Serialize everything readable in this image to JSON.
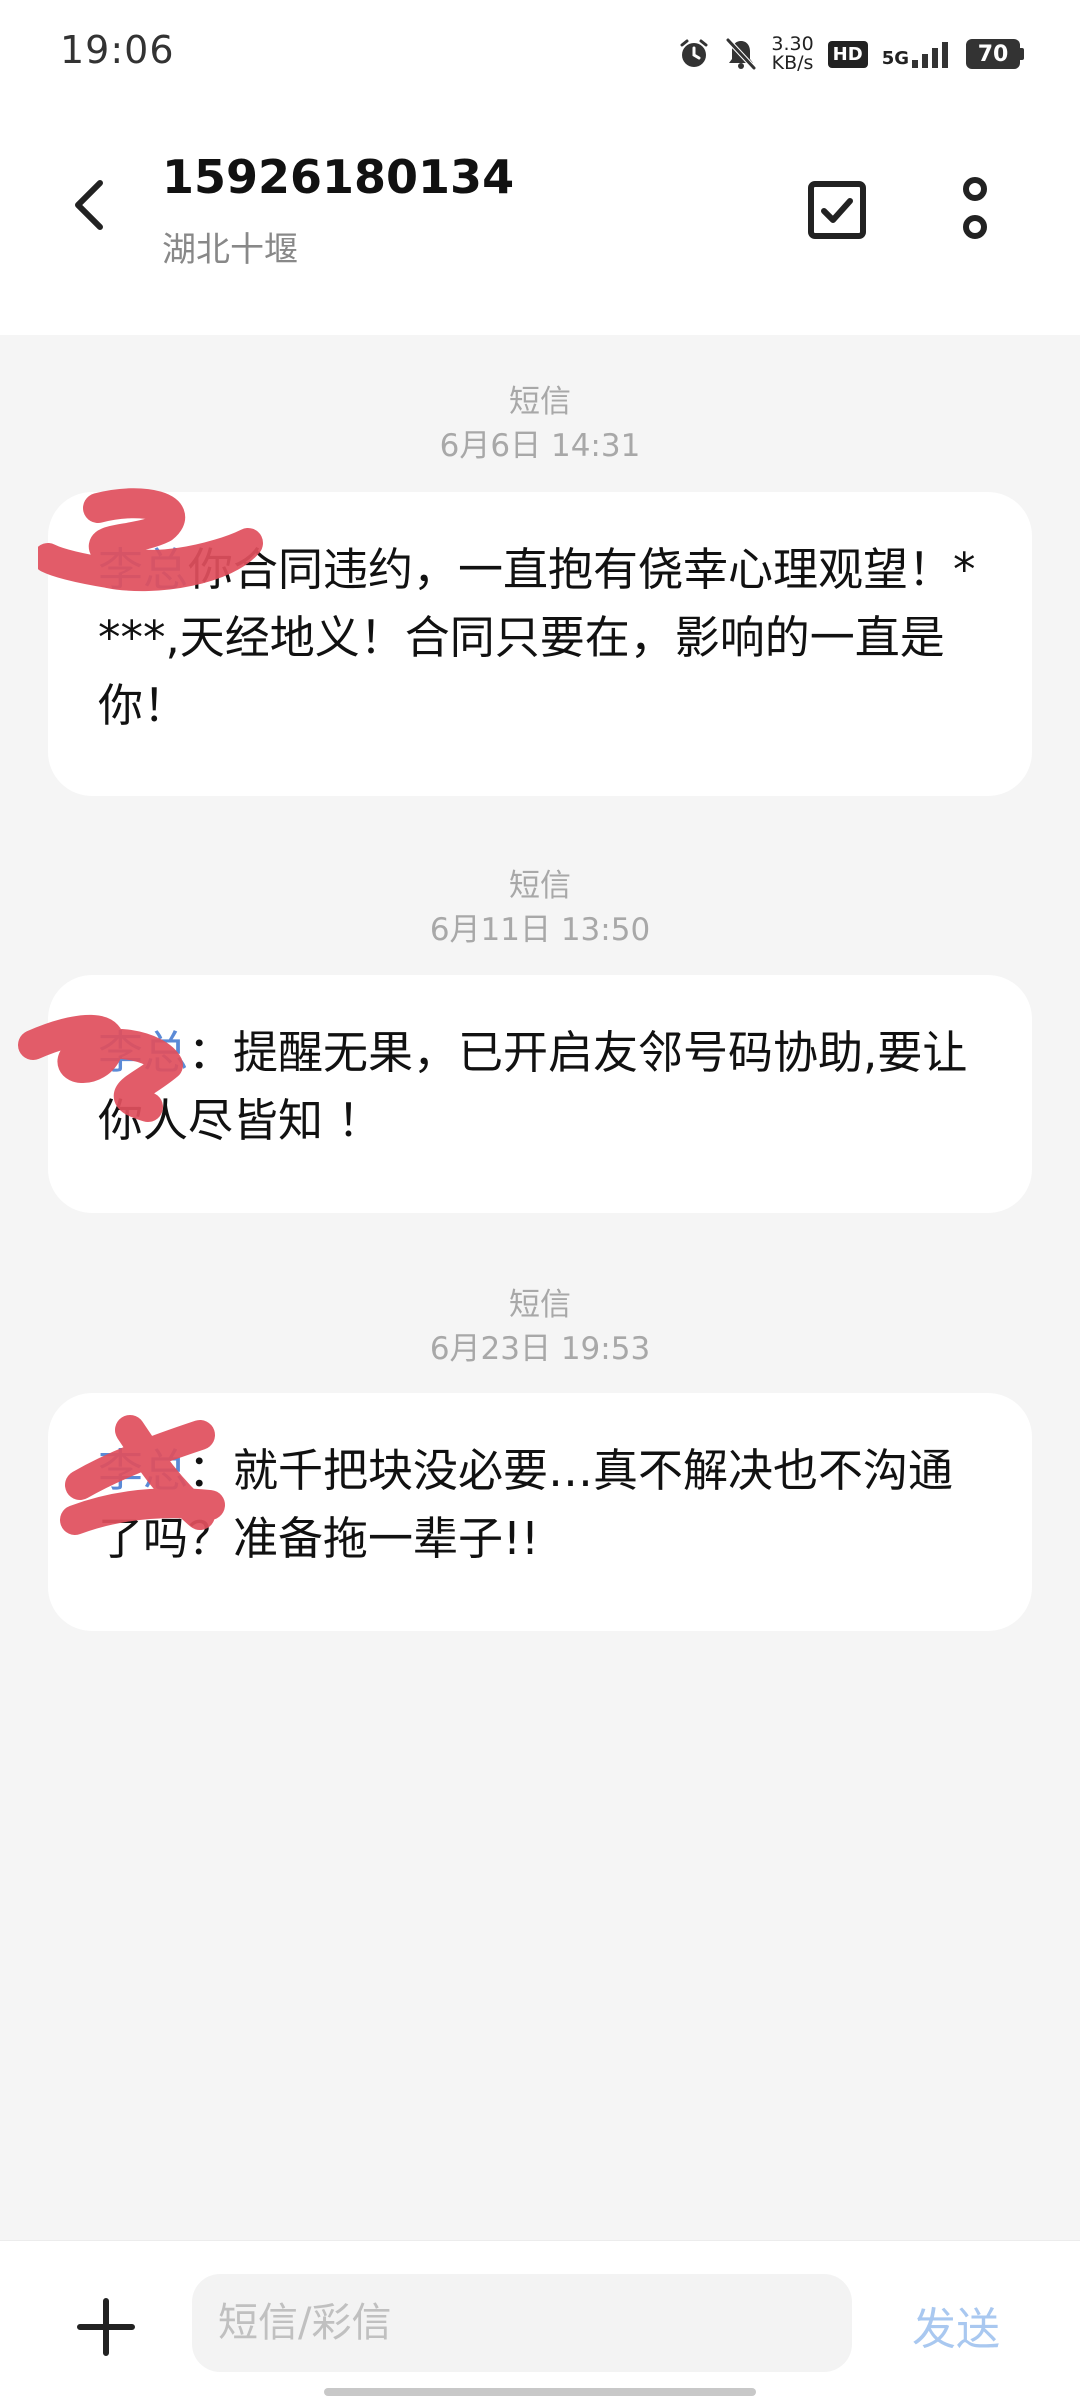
{
  "status_bar": {
    "time": "19:06",
    "net_speed_value": "3.30",
    "net_speed_unit": "KB/s",
    "hd_label": "HD",
    "network_label": "5G",
    "battery_level": "70"
  },
  "header": {
    "contact_number": "15926180134",
    "contact_location": "湖北十堰"
  },
  "messages": [
    {
      "type_label": "短信",
      "timestamp": "6月6日 14:31",
      "sender_fragment": "李总",
      "body": "你合同违约，一直抱有侥幸心理观望！****,天经地义！合同只要在，影响的一直是你！"
    },
    {
      "type_label": "短信",
      "timestamp": "6月11日 13:50",
      "sender_fragment": "李总",
      "body": "：提醒无果，已开启友邻号码协助,要让你人尽皆知 ！"
    },
    {
      "type_label": "短信",
      "timestamp": "6月23日 19:53",
      "sender_fragment": "李总",
      "body": "：就千把块没必要…真不解决也不沟通了吗？准备拖一辈子!!"
    }
  ],
  "composer": {
    "placeholder": "短信/彩信",
    "send_label": "发送"
  },
  "colors": {
    "background": "#f5f5f5",
    "bubble": "#ffffff",
    "send_disabled": "#a9c8f0",
    "redaction": "#e0505e"
  },
  "icons": {
    "back": "chevron-left-icon",
    "select": "checkbox-icon",
    "more": "more-vertical-icon",
    "add": "plus-icon",
    "alarm": "alarm-icon",
    "mute": "bell-off-icon"
  }
}
